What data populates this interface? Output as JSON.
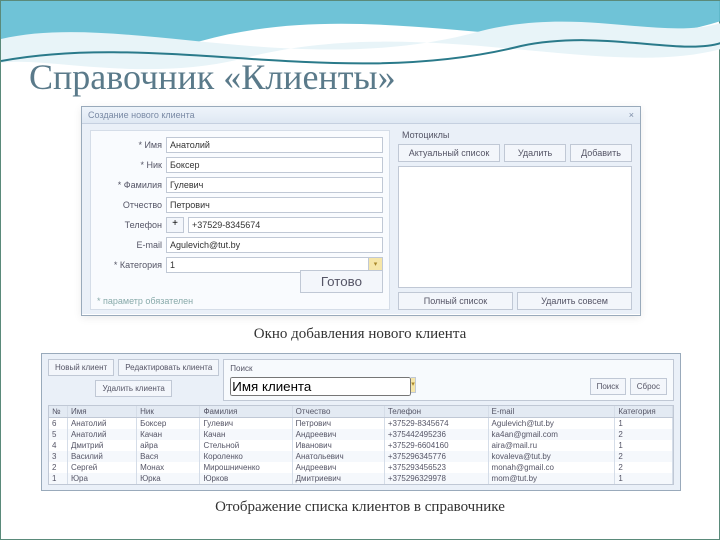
{
  "slide": {
    "title": "Справочник «Клиенты»",
    "caption1": "Окно добавления нового клиента",
    "caption2": "Отображение списка клиентов в справочнике"
  },
  "dialog": {
    "title": "Создание нового клиента",
    "close": "×",
    "labels": {
      "name": "* Имя",
      "nick": "* Ник",
      "surname": "* Фамилия",
      "patronym": "Отчество",
      "phone": "Телефон",
      "email": "E-mail",
      "category": "* Категория"
    },
    "values": {
      "name": "Анатолий",
      "nick": "Боксер",
      "surname": "Гулевич",
      "patronym": "Петрович",
      "phone_btn": "+",
      "phone": "+37529-8345674",
      "email": "Agulevich@tut.by",
      "category": "1",
      "category_arrow": "▾"
    },
    "done": "Готово",
    "footnote": "* параметр обязателен",
    "moto": {
      "header": "Мотоциклы",
      "actual": "Актуальный список",
      "delete": "Удалить",
      "add": "Добавить",
      "full": "Полный список",
      "remove": "Удалить совсем"
    }
  },
  "list": {
    "btn_new": "Новый клиент",
    "btn_edit": "Редактировать клиента",
    "btn_del": "Удалить клиента",
    "search_label": "Поиск",
    "search_field": "Имя клиента",
    "search_arrow": "▾",
    "btn_search": "Поиск",
    "btn_reset": "Сброс",
    "columns": {
      "n": "№",
      "name": "Имя",
      "nick": "Ник",
      "fam": "Фамилия",
      "ot": "Отчество",
      "tel": "Телефон",
      "email": "E-mail",
      "cat": "Категория"
    },
    "rows": [
      {
        "n": "6",
        "name": "Анатолий",
        "nick": "Боксер",
        "fam": "Гулевич",
        "ot": "Петрович",
        "tel": "+37529-8345674",
        "email": "Agulevich@tut.by",
        "cat": "1"
      },
      {
        "n": "5",
        "name": "Анатолий",
        "nick": "Качан",
        "fam": "Качан",
        "ot": "Андреевич",
        "tel": "+375442495236",
        "email": "ka4an@gmail.com",
        "cat": "2"
      },
      {
        "n": "4",
        "name": "Дмитрий",
        "nick": "айра",
        "fam": "Стельной",
        "ot": "Иванович",
        "tel": "+37529-6604160",
        "email": "aira@mail.ru",
        "cat": "1"
      },
      {
        "n": "3",
        "name": "Василий",
        "nick": "Вася",
        "fam": "Короленко",
        "ot": "Анатольевич",
        "tel": "+375296345776",
        "email": "kovaleva@tut.by",
        "cat": "2"
      },
      {
        "n": "2",
        "name": "Сергей",
        "nick": "Монах",
        "fam": "Мирошниченко",
        "ot": "Андреевич",
        "tel": "+375293456523",
        "email": "monah@gmail.co",
        "cat": "2"
      },
      {
        "n": "1",
        "name": "Юра",
        "nick": "Юрка",
        "fam": "Юрков",
        "ot": "Дмитриевич",
        "tel": "+375296329978",
        "email": "mom@tut.by",
        "cat": "1"
      }
    ]
  }
}
